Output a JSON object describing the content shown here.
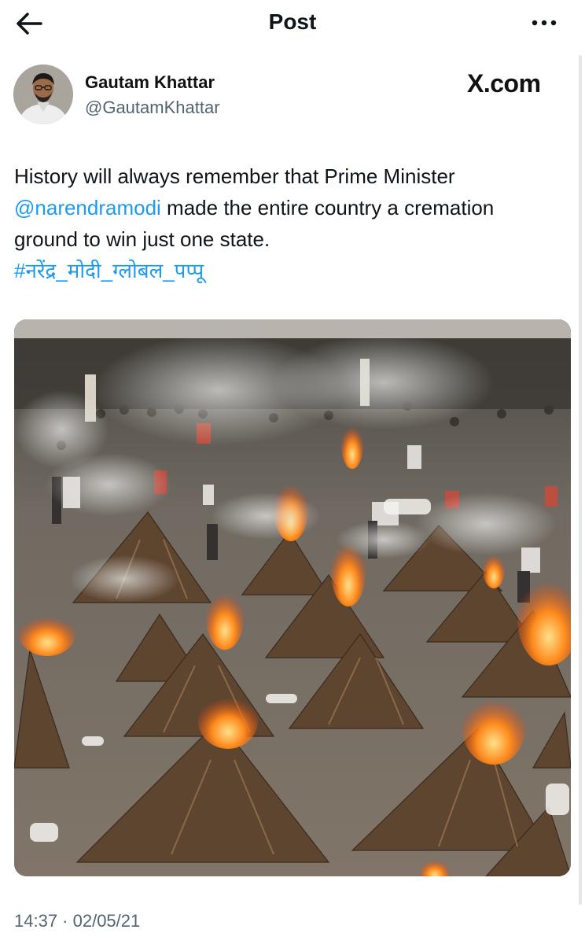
{
  "header": {
    "title": "Post",
    "back_icon": "arrow-left-icon",
    "more_icon": "more-horizontal-icon"
  },
  "author": {
    "name": "Gautam Khattar",
    "handle": "@GautamKhattar"
  },
  "brand": "X.com",
  "post": {
    "line1": "History will always remember that Prime Minister",
    "mention": "@narendramodi",
    "line2_rest": " made the entire country a cremation",
    "line3": "ground to win just one state.",
    "hashtag": "#नरेंद्र_मोदी_ग्लोबल_पप्पू"
  },
  "timestamp": "14:37 · 02/05/21",
  "colors": {
    "link": "#1d9bf0",
    "secondary_text": "#536471",
    "primary_text": "#0f1419"
  }
}
